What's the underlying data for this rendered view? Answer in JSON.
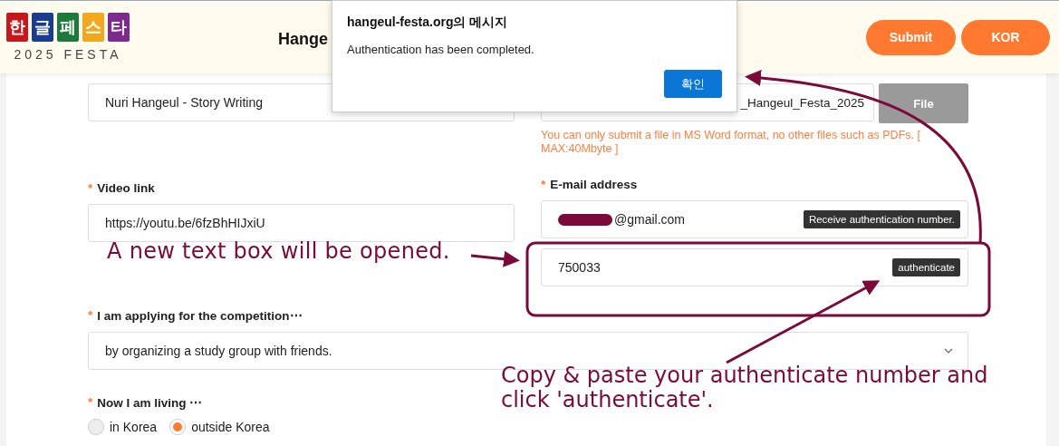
{
  "header": {
    "logo": {
      "letters": [
        {
          "char": "한",
          "color": "#c8161d"
        },
        {
          "char": "글",
          "color": "#1a3d8f"
        },
        {
          "char": "페",
          "color": "#1e7a3a"
        },
        {
          "char": "스",
          "color": "#f2a81d"
        },
        {
          "char": "타",
          "color": "#7d2a8e"
        }
      ],
      "subtitle": "2025 FESTA"
    },
    "title": "Hange",
    "buttons": [
      "Submit",
      "KOR"
    ]
  },
  "dialog": {
    "title": "hangeul-festa.org의 메시지",
    "message": "Authentication has been completed.",
    "button": "확인"
  },
  "form": {
    "category": {
      "value": "Nuri Hangeul - Story Writing"
    },
    "file": {
      "value": "_Hangeul_Festa_2025",
      "button": "File",
      "hint": "You can only submit a file in MS Word format, no other files such as PDFs. [ MAX:40Mbyte ]"
    },
    "video": {
      "label": "Video link",
      "required_mark": "*",
      "value": "https://youtu.be/6fzBhHIJxiU"
    },
    "email": {
      "label": "E-mail address",
      "required_mark": "*",
      "value": "@gmail.com",
      "redacted": true,
      "button": "Receive authentication number."
    },
    "auth": {
      "value": "750033",
      "button": "authenticate"
    },
    "applying": {
      "label": "I am applying for the competition⋯",
      "required_mark": "*",
      "value": "by organizing a study group with friends."
    },
    "living": {
      "label": "Now I am living ⋯",
      "required_mark": "*",
      "options": [
        {
          "label": "in Korea",
          "selected": false
        },
        {
          "label": "outside Korea",
          "selected": true
        }
      ]
    }
  },
  "annotations": [
    {
      "text": "A new text box will be opened."
    },
    {
      "text": "Copy & paste your authenticate number and click 'authenticate'."
    }
  ]
}
